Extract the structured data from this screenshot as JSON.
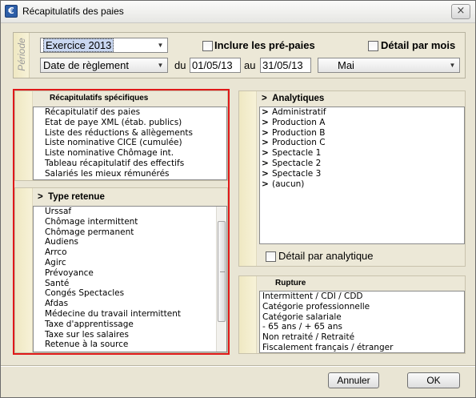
{
  "window": {
    "title": "Récapitulatifs des paies",
    "app_icon": "€",
    "close_icon": "×"
  },
  "periode": {
    "label": "Période",
    "exercice": {
      "value": "Exercice 2013"
    },
    "inclure_pre_paies": {
      "label": "Inclure les pré-paies",
      "checked": false
    },
    "detail_par_mois": {
      "label": "Détail par mois",
      "checked": false
    },
    "date_type": {
      "value": "Date de règlement"
    },
    "du_label": "du",
    "date_from": "01/05/13",
    "au_label": "au",
    "date_to": "31/05/13",
    "month": {
      "value": "Mai"
    },
    "dropdown_arrow": "▼"
  },
  "recap_specifiques": {
    "header": "Récapitulatifs spécifiques",
    "items": [
      "Récapitulatif des paies",
      "Etat de paye XML (étab. publics)",
      "Liste des réductions & allègements",
      "Liste nominative CICE (cumulée)",
      "Liste nominative Chômage int.",
      "Tableau récapitulatif des effectifs",
      "Salariés les mieux rémunérés"
    ]
  },
  "type_retenue": {
    "header_arrow": ">",
    "header": "Type retenue",
    "items": [
      "Urssaf",
      "Chômage intermittent",
      "Chômage permanent",
      "Audiens",
      "Arrco",
      "Agirc",
      "Prévoyance",
      "Santé",
      "Congés Spectacles",
      "Afdas",
      "Médecine du travail intermittent",
      "Taxe d'apprentissage",
      "Taxe sur les salaires",
      "Retenue à la source"
    ]
  },
  "analytiques": {
    "header_arrow": ">",
    "header": "Analytiques",
    "item_marker": ">",
    "items": [
      "Administratif",
      "Production A",
      "Production B",
      "Production C",
      "Spectacle 1",
      "Spectacle 2",
      "Spectacle 3",
      "(aucun)"
    ],
    "detail_par_analytique": {
      "label": "Détail par analytique",
      "checked": false
    }
  },
  "rupture": {
    "header": "Rupture",
    "items": [
      "Intermittent / CDI / CDD",
      "Catégorie professionnelle",
      "Catégorie salariale",
      "- 65 ans / + 65 ans",
      "Non retraité / Retraité",
      "Fiscalement français / étranger"
    ]
  },
  "buttons": {
    "cancel": "Annuler",
    "ok": "OK"
  }
}
